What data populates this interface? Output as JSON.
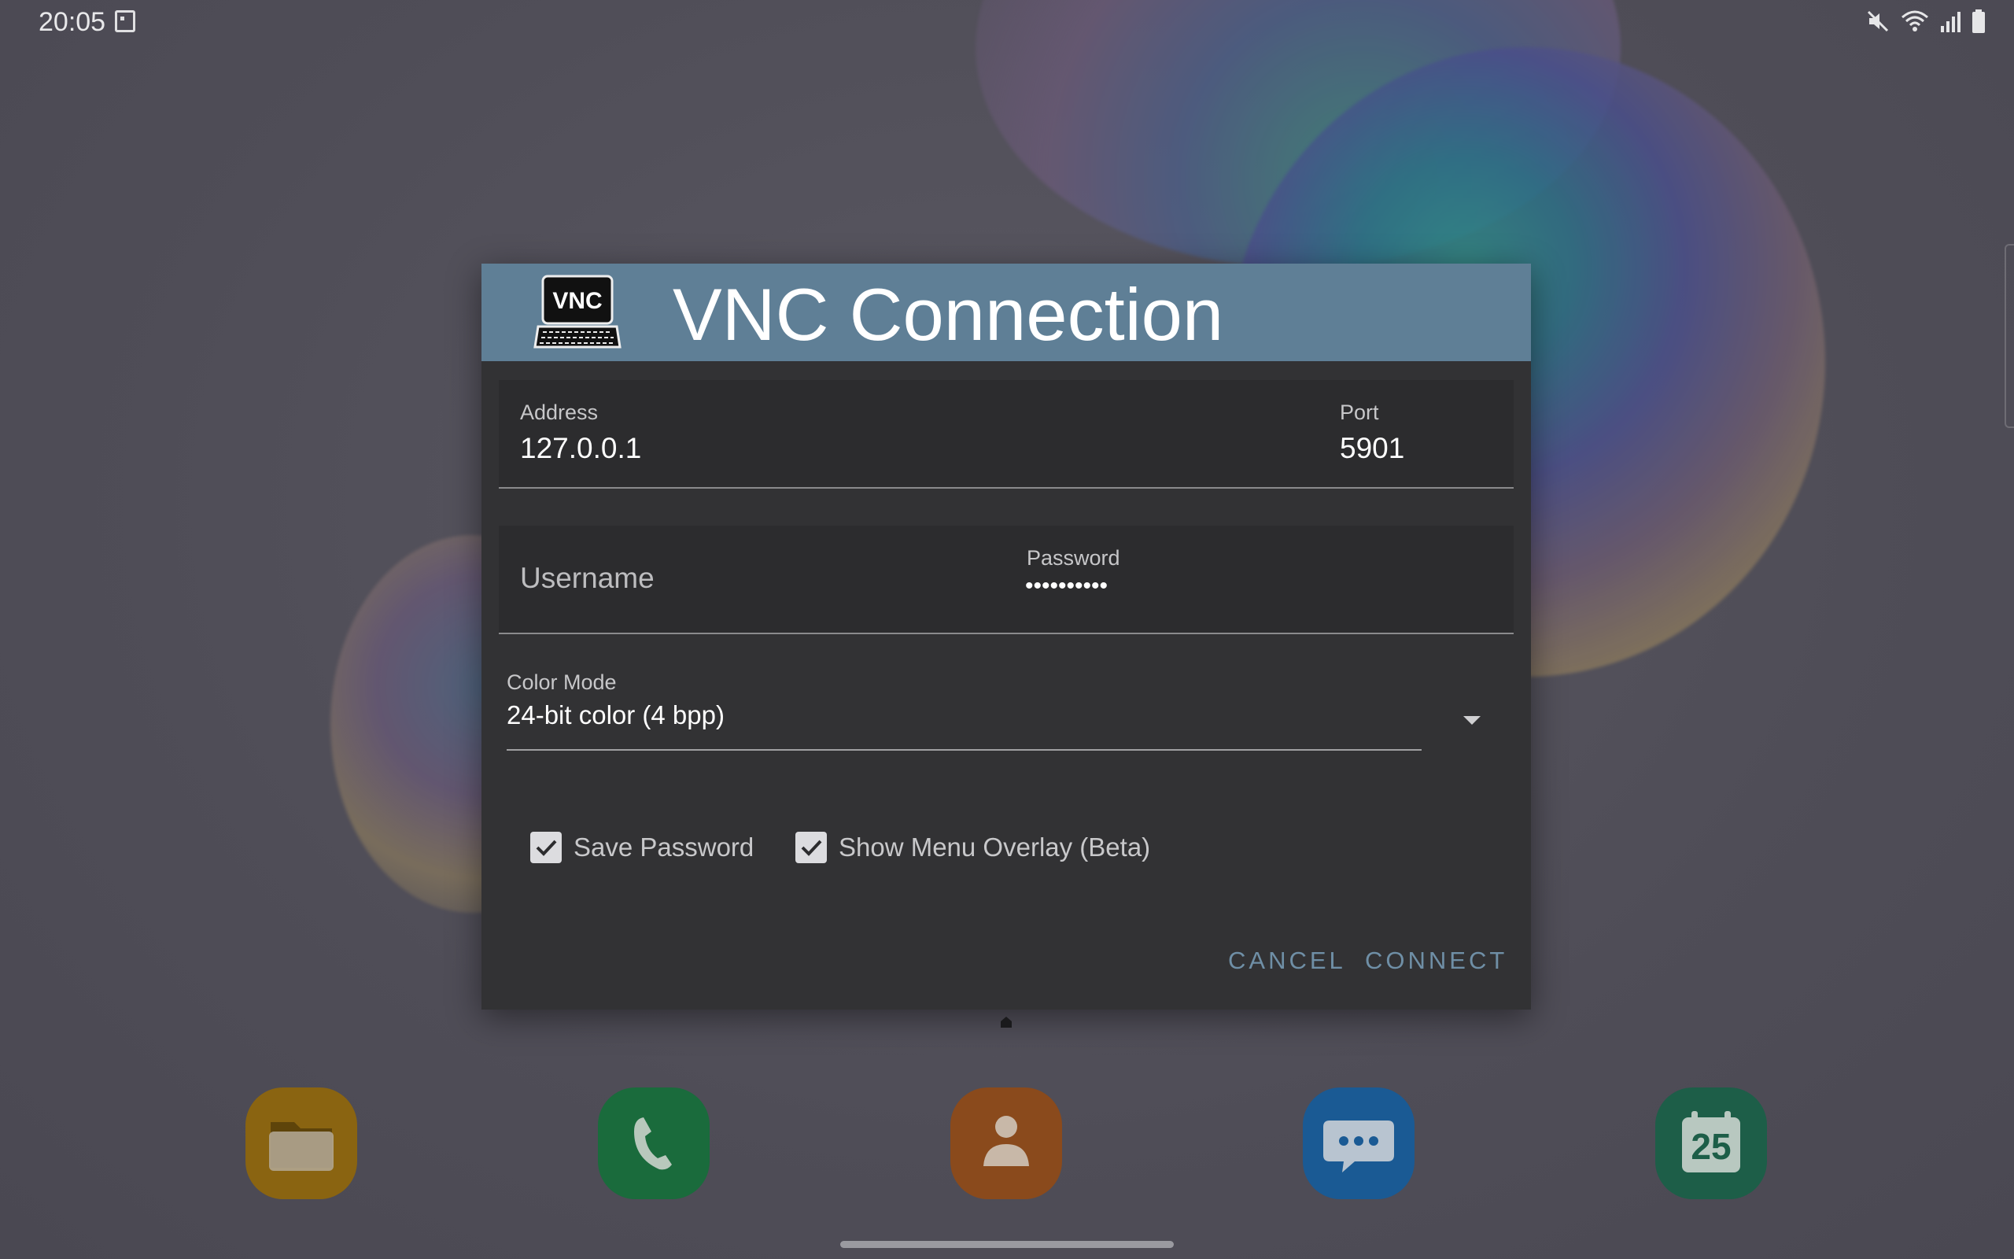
{
  "status_bar": {
    "time": "20:05",
    "left_icons": [
      "screenshot-icon"
    ],
    "right_icons": [
      "mute-icon",
      "wifi-icon",
      "signal-icon",
      "battery-icon"
    ]
  },
  "dialog": {
    "title": "VNC Connection",
    "logo_text": "VNC",
    "address": {
      "label": "Address",
      "value": "127.0.0.1"
    },
    "port": {
      "label": "Port",
      "value": "5901"
    },
    "username": {
      "placeholder": "Username",
      "value": ""
    },
    "password": {
      "label": "Password",
      "value": "••••••••••"
    },
    "color_mode": {
      "label": "Color Mode",
      "selected": "24-bit color (4 bpp)"
    },
    "save_password": {
      "label": "Save Password",
      "checked": true
    },
    "show_menu_overlay": {
      "label": "Show Menu Overlay (Beta)",
      "checked": true
    },
    "buttons": {
      "cancel": "CANCEL",
      "connect": "CONNECT"
    },
    "accent_color": "#5f7f96"
  },
  "dock": {
    "apps": [
      {
        "name": "my-files",
        "icon": "folder-icon",
        "color": "#8a6411"
      },
      {
        "name": "phone",
        "icon": "phone-icon",
        "color": "#1a6b3c"
      },
      {
        "name": "contacts",
        "icon": "contact-icon",
        "color": "#8a4a1c"
      },
      {
        "name": "messages",
        "icon": "message-icon",
        "color": "#1a5a94"
      },
      {
        "name": "calendar",
        "icon": "calendar-icon",
        "color": "#1d5e48",
        "day": "25"
      }
    ]
  }
}
